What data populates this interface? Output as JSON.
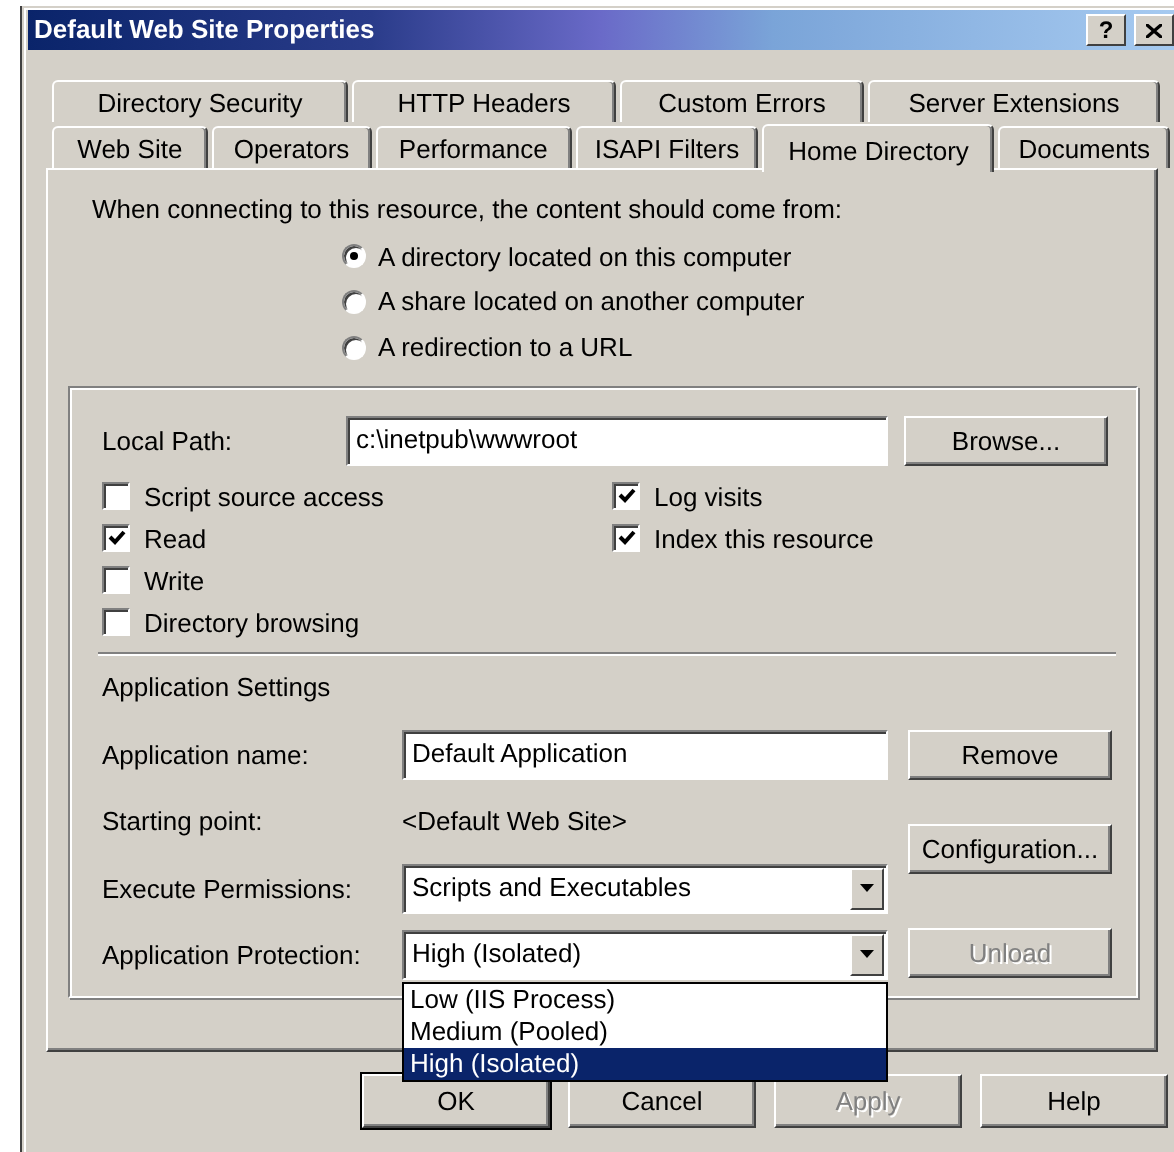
{
  "window": {
    "title": "Default Web Site Properties",
    "help_button": "?"
  },
  "tab_rows": [
    [
      {
        "label": "Directory Security",
        "selected": false
      },
      {
        "label": "HTTP Headers",
        "selected": false
      },
      {
        "label": "Custom Errors",
        "selected": false
      },
      {
        "label": "Server Extensions",
        "selected": false
      }
    ],
    [
      {
        "label": "Web Site",
        "selected": false
      },
      {
        "label": "Operators",
        "selected": false
      },
      {
        "label": "Performance",
        "selected": false
      },
      {
        "label": "ISAPI Filters",
        "selected": false
      },
      {
        "label": "Home Directory",
        "selected": true
      },
      {
        "label": "Documents",
        "selected": false
      }
    ]
  ],
  "source": {
    "prompt": "When connecting to this resource, the content should come from:",
    "options": [
      {
        "label": "A directory located on this computer",
        "selected": true
      },
      {
        "label": "A share located on another computer",
        "selected": false
      },
      {
        "label": "A redirection to a URL",
        "selected": false
      }
    ]
  },
  "local_path": {
    "label": "Local Path:",
    "value": "c:\\inetpub\\wwwroot",
    "button": "Browse..."
  },
  "checkboxes_left": [
    {
      "label": "Script source access",
      "checked": false
    },
    {
      "label": "Read",
      "checked": true
    },
    {
      "label": "Write",
      "checked": false
    },
    {
      "label": "Directory browsing",
      "checked": false
    }
  ],
  "checkboxes_right": [
    {
      "label": "Log visits",
      "checked": true
    },
    {
      "label": "Index this resource",
      "checked": true
    }
  ],
  "app_settings": {
    "heading": "Application Settings",
    "fields": [
      {
        "kind": "text",
        "label": "Application name:",
        "value": "Default Application"
      },
      {
        "kind": "static",
        "label": "Starting point:",
        "value": "<Default Web Site>"
      },
      {
        "kind": "select",
        "label": "Execute Permissions:",
        "value": "Scripts and Executables"
      },
      {
        "kind": "select",
        "label": "Application Protection:",
        "value": "High (Isolated)",
        "options": [
          {
            "label": "Low (IIS Process)",
            "selected": false
          },
          {
            "label": "Medium (Pooled)",
            "selected": false
          },
          {
            "label": "High (Isolated)",
            "selected": true
          }
        ]
      }
    ],
    "buttons": [
      {
        "label": "Remove",
        "disabled": false
      },
      {
        "label": "Configuration...",
        "disabled": false
      },
      {
        "label": "Unload",
        "disabled": true
      }
    ]
  },
  "buttons": [
    {
      "label": "OK",
      "disabled": false,
      "default": true
    },
    {
      "label": "Cancel",
      "disabled": false,
      "default": false
    },
    {
      "label": "Apply",
      "disabled": true,
      "default": false
    },
    {
      "label": "Help",
      "disabled": false,
      "default": false
    }
  ]
}
